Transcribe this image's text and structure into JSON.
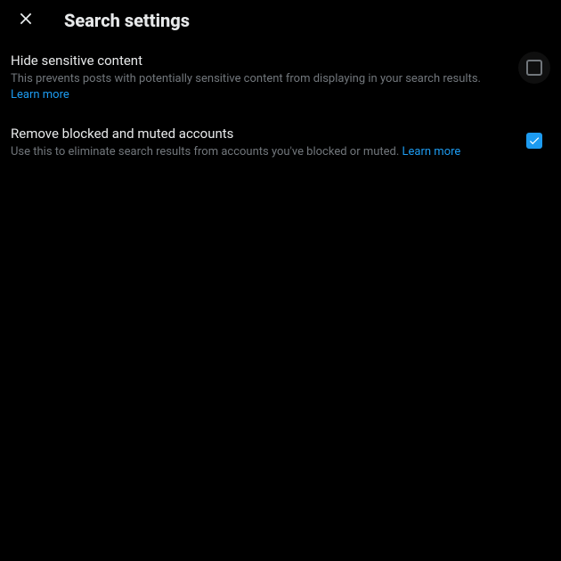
{
  "header": {
    "title": "Search settings",
    "close_icon": "close"
  },
  "settings": {
    "hide_sensitive": {
      "title": "Hide sensitive content",
      "description": "This prevents posts with potentially sensitive content from displaying in your search results.",
      "learn_more": "Learn more",
      "checked": false
    },
    "remove_blocked": {
      "title": "Remove blocked and muted accounts",
      "description": "Use this to eliminate search results from accounts you've blocked or muted.",
      "learn_more": "Learn more",
      "checked": true
    }
  },
  "colors": {
    "background": "#000000",
    "text_primary": "#e7e9ea",
    "text_secondary": "#71767b",
    "link": "#1d9bf0",
    "checkbox_checked": "#1d9bf0"
  }
}
